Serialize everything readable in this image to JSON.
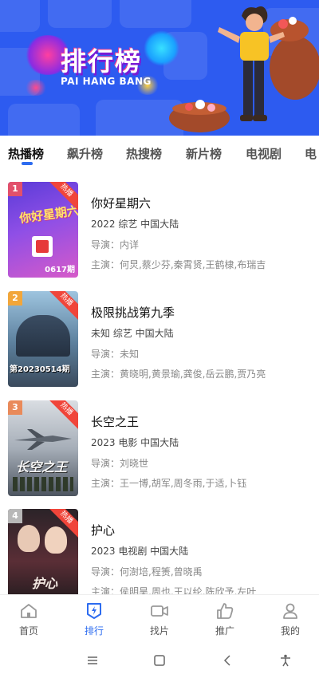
{
  "banner": {
    "title": "排行榜",
    "subtitle": "PAI HANG BANG"
  },
  "tabs": [
    {
      "label": "热播榜",
      "active": true
    },
    {
      "label": "飙升榜",
      "active": false
    },
    {
      "label": "热搜榜",
      "active": false
    },
    {
      "label": "新片榜",
      "active": false
    },
    {
      "label": "电视剧",
      "active": false
    },
    {
      "label": "电",
      "active": false
    }
  ],
  "items": [
    {
      "rank": "1",
      "badge": "热播",
      "title": "你好星期六",
      "meta": "2022  综艺  中国大陆",
      "director": "导演：内详",
      "actors": "主演：何炅,蔡少芬,秦霄贤,王鹤棣,布瑞吉",
      "poster_caption": "0617期",
      "poster_text": "你好星期六"
    },
    {
      "rank": "2",
      "badge": "热播",
      "title": "极限挑战第九季",
      "meta": "未知  综艺  中国大陆",
      "director": "导演：未知",
      "actors": "主演：黄晓明,黄景瑜,龚俊,岳云鹏,贾乃亮",
      "poster_caption": "第20230514期"
    },
    {
      "rank": "3",
      "badge": "热播",
      "title": "长空之王",
      "meta": "2023  电影  中国大陆",
      "director": "导演：刘晓世",
      "actors": "主演：王一博,胡军,周冬雨,于适,卜钰",
      "poster_caption": "长空之王"
    },
    {
      "rank": "4",
      "badge": "热播",
      "title": "护心",
      "meta": "2023  电视剧  中国大陆",
      "director": "导演：何澍培,程箦,曾晓禹",
      "actors": "主演：侯明昊,周也,王以纶,陈欣予,左叶",
      "poster_caption": "护心"
    }
  ],
  "nav": [
    {
      "label": "首页",
      "icon": "home-icon",
      "active": false
    },
    {
      "label": "排行",
      "icon": "ranking-icon",
      "active": true
    },
    {
      "label": "找片",
      "icon": "video-camera-icon",
      "active": false
    },
    {
      "label": "推广",
      "icon": "thumbs-up-icon",
      "active": false
    },
    {
      "label": "我的",
      "icon": "user-icon",
      "active": false
    }
  ],
  "colors": {
    "accent": "#2d6cf0",
    "banner": "#2d5bf0",
    "hot_badge": "#f0453a",
    "rank_badges": [
      "#e2506b",
      "#f2a63a",
      "#e98a5a",
      "#b8b8b8"
    ]
  }
}
